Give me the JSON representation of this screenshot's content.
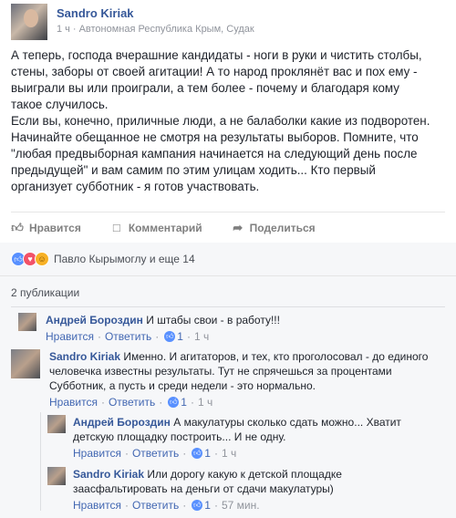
{
  "post": {
    "author": "Sandro Kiriak",
    "time": "1 ч",
    "location": "Автономная Республика Крым, Судак",
    "paragraph1": "А теперь, господа вчерашние кандидаты - ноги в руки и чистить столбы,\nстены, заборы от своей агитации! А то народ проклянёт вас и пох ему -\nвыиграли вы или проиграли, а тем более - почему и благодаря кому\nтакое случилось.",
    "paragraph2": "Если вы, конечно, приличные люди, а не балаболки какие из подворотен.\nНачинайте обещанное не смотря на результаты выборов. Помните, что\n\"любая предвыборная кампания начинается на следующий день после\nпредыдущей\" и вам самим по этим улицам ходить... Кто первый\nорганизует субботник - я готов участвовать."
  },
  "actions": {
    "like": "Нравится",
    "comment": "Комментарий",
    "share": "Поделиться"
  },
  "reactions": {
    "summary": "Павло Кырымоглу и еще 14"
  },
  "comments_header": "2 публикации",
  "comments": [
    {
      "name": "Андрей Бороздин",
      "text": " И штабы свои - в работу!!!",
      "like": "Нравится",
      "reply": "Ответить",
      "likes": "1",
      "time": "1 ч"
    },
    {
      "name": "Sandro Kiriak",
      "text": " Именно. И агитаторов, и тех, кто проголосовал - до единого\nчеловечка известны результаты. Тут не спрячешься за процентами\nСубботник, а пусть и среди недели - это нормально.",
      "like": "Нравится",
      "reply": "Ответить",
      "likes": "1",
      "time": "1 ч"
    },
    {
      "name": "Андрей Бороздин",
      "text": " А макулатуры сколько сдать можно... Хватит\nдетскую площадку построить... И не одну.",
      "like": "Нравится",
      "reply": "Ответить",
      "likes": "1",
      "time": "1 ч"
    },
    {
      "name": "Sandro Kiriak",
      "text": " Или дорогу какую к детской площадке\nзаасфальтировать на деньги от сдачи макулатуры)",
      "like": "Нравится",
      "reply": "Ответить",
      "likes": "1",
      "time": "57 мин."
    }
  ]
}
